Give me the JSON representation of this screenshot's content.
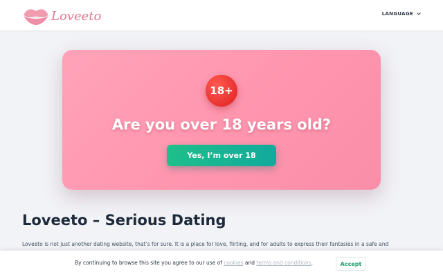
{
  "header": {
    "logo_text": "Loveeto",
    "language_label": "LANGUAGE",
    "language_icon": "chevron-down-icon"
  },
  "age_gate": {
    "badge": "18+",
    "question": "Are you over 18 years old?",
    "confirm_label": "Yes, I’m over 18"
  },
  "article": {
    "title": "Loveeto – Serious Dating",
    "body": "Loveeto is not just another dating website, that’s for sure. It is a place for love, flirting, and for adults to express their fantasies in a safe and"
  },
  "cookie_bar": {
    "text_before": "By continuing to browse this site you agree to our use of",
    "cookies_link": "cookies",
    "text_and": "and",
    "terms_link": "terms and conditions",
    "text_after": ".",
    "accept_label": "Accept"
  },
  "colors": {
    "brand_pink": "#e27a93",
    "card_pink": "#ff95ae",
    "badge_red": "#e8312f",
    "button_green": "#1fbf8a",
    "accept_green": "#1f9d6b"
  }
}
